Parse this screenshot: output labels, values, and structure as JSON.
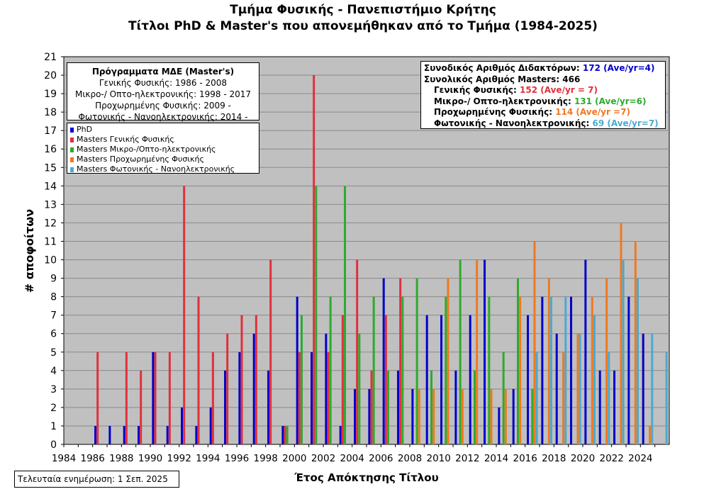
{
  "chart_data": {
    "type": "bar",
    "title": "Τμήμα Φυσικής - Πανεπιστήμιο Κρήτης",
    "subtitle": "Τίτλοι PhD & Master's που απονεμήθηκαν από το Τμήμα (1984-2025)",
    "xlabel": "Έτος Απόκτησης Τίτλου",
    "ylabel": "# αποφοίτων",
    "ylim": [
      0,
      21
    ],
    "yticks": [
      "0",
      "1",
      "2",
      "3",
      "4",
      "5",
      "6",
      "7",
      "8",
      "9",
      "10",
      "11",
      "12",
      "13",
      "14",
      "15",
      "16",
      "17",
      "18",
      "19",
      "20",
      "21"
    ],
    "xtick_labels": [
      "1984",
      "1986",
      "1988",
      "1990",
      "1992",
      "1994",
      "1996",
      "1998",
      "2000",
      "2002",
      "2004",
      "2006",
      "2008",
      "2010",
      "2012",
      "2014",
      "2016",
      "2018",
      "2020",
      "2022",
      "2024"
    ],
    "grid": "horizontal",
    "categories": [
      1984,
      1985,
      1986,
      1987,
      1988,
      1989,
      1990,
      1991,
      1992,
      1993,
      1994,
      1995,
      1996,
      1997,
      1998,
      1999,
      2000,
      2001,
      2002,
      2003,
      2004,
      2005,
      2006,
      2007,
      2008,
      2009,
      2010,
      2011,
      2012,
      2013,
      2014,
      2015,
      2016,
      2017,
      2018,
      2019,
      2020,
      2021,
      2022,
      2023,
      2024,
      2025
    ],
    "series": [
      {
        "name": "PhD",
        "color": "#0000cc",
        "values": [
          0,
          0,
          1,
          1,
          1,
          1,
          5,
          1,
          2,
          1,
          2,
          4,
          5,
          6,
          4,
          1,
          8,
          5,
          6,
          1,
          3,
          3,
          9,
          4,
          3,
          7,
          7,
          4,
          7,
          10,
          2,
          3,
          7,
          8,
          6,
          8,
          10,
          4,
          4,
          8,
          6,
          0
        ]
      },
      {
        "name": "Masters Γενικής Φυσικής",
        "color": "#e0303c",
        "values": [
          0,
          0,
          5,
          0,
          5,
          4,
          5,
          5,
          14,
          8,
          5,
          6,
          7,
          7,
          10,
          1,
          5,
          20,
          5,
          7,
          10,
          4,
          7,
          9,
          0,
          0,
          0,
          0,
          0,
          0,
          0,
          0,
          0,
          0,
          0,
          0,
          0,
          0,
          0,
          0,
          0,
          0
        ]
      },
      {
        "name": "Masters Μικρο-/Οπτο-ηλεκτρονικής",
        "color": "#2eaa2e",
        "values": [
          0,
          0,
          0,
          0,
          0,
          0,
          0,
          0,
          0,
          0,
          0,
          0,
          0,
          0,
          0,
          1,
          7,
          14,
          8,
          14,
          6,
          8,
          4,
          8,
          9,
          4,
          8,
          10,
          4,
          8,
          5,
          9,
          3,
          0,
          0,
          0,
          0,
          0,
          0,
          0,
          0,
          0
        ]
      },
      {
        "name": "Masters Προχωρημένης Φυσικής",
        "color": "#f07820",
        "values": [
          0,
          0,
          0,
          0,
          0,
          0,
          0,
          0,
          0,
          0,
          0,
          0,
          0,
          0,
          0,
          0,
          0,
          0,
          0,
          0,
          0,
          0,
          0,
          0,
          3,
          3,
          9,
          3,
          10,
          3,
          3,
          8,
          11,
          9,
          5,
          6,
          8,
          9,
          12,
          11,
          1,
          0
        ]
      },
      {
        "name": "Masters Φωτονικής - Νανοηλεκτρονικής",
        "color": "#4aaad0",
        "values": [
          0,
          0,
          0,
          0,
          0,
          0,
          0,
          0,
          0,
          0,
          0,
          0,
          0,
          0,
          0,
          0,
          0,
          0,
          0,
          0,
          0,
          0,
          0,
          0,
          0,
          0,
          0,
          0,
          0,
          0,
          0,
          0,
          5,
          8,
          8,
          6,
          7,
          5,
          10,
          9,
          6,
          5
        ]
      }
    ],
    "legend": [
      "PhD",
      "Masters Γενικής Φυσικής",
      "Masters Μικρο-/Οπτο-ηλεκτρονικής",
      "Masters Προχωρημένης Φυσικής",
      "Masters Φωτονικής - Νανοηλεκτρονικής"
    ],
    "legend_position": "top-left",
    "programs_box": {
      "heading": "Πρόγραμματα ΜΔΕ (Master's)",
      "lines": [
        "Γενικής Φυσικής: 1986 - 2008",
        "Μικρο-/ Οπτο-ηλεκτρονικής: 1998 - 2017",
        "Προχωρημένης Φυσικής: 2009 -",
        "Φωτονικής - Νανοηλεκτρονικής: 2014 -"
      ]
    },
    "stats_box": {
      "phd_label": "Συνοδικός Αριθμός Διδακτόρων:",
      "phd_value": "172 (Ave/yr=4)",
      "phd_color": "#0000cc",
      "masters_label": "Συνολικός Αριθμός Masters: 466",
      "gen_label": "Γενικής Φυσικής:",
      "gen_value": "152 (Ave/yr = 7)",
      "gen_color": "#e0303c",
      "micro_label": "Μικρο-/ Οπτο-ηλεκτρονικής:",
      "micro_value": "131 (Ave/yr=6)",
      "micro_color": "#2eaa2e",
      "adv_label": "Προχωρημένης Φυσικής:",
      "adv_value": "114 (Ave/yr =7)",
      "adv_color": "#f07820",
      "phot_label": "Φωτονικής - Νανοηλεκτρονικής:",
      "phot_value": "69 (Ave/yr=7)",
      "phot_color": "#4aaad0"
    },
    "footer": "Τελευταία ενημέρωση: 1 Σεπ. 2025"
  }
}
